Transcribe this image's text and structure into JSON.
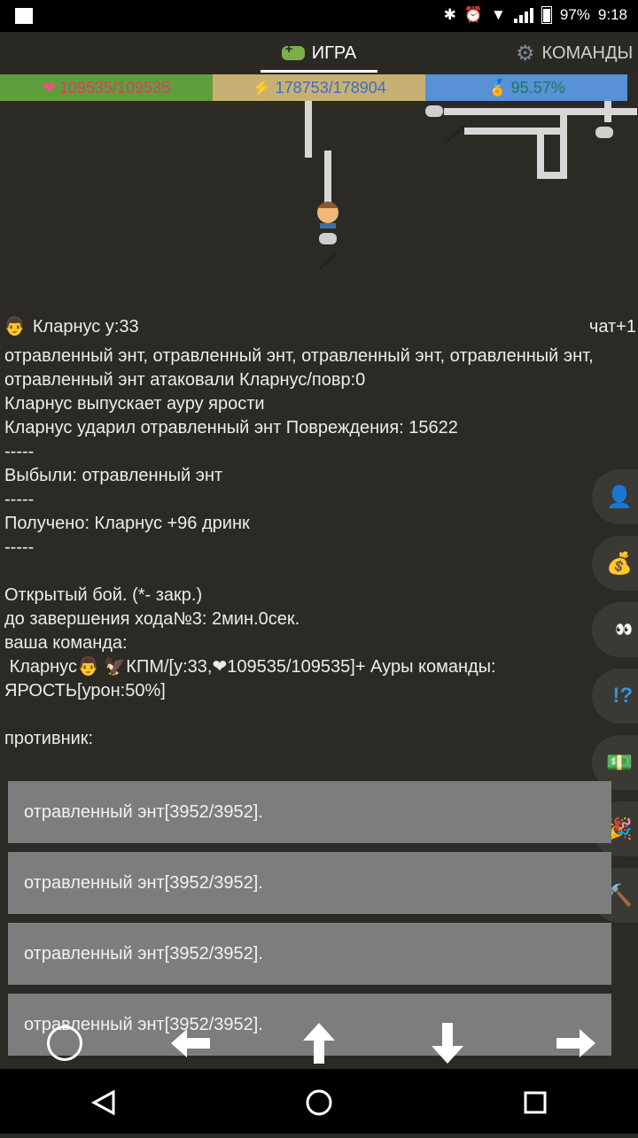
{
  "status_bar": {
    "battery": "97%",
    "time": "9:18",
    "icons": [
      "bluetooth-icon",
      "alarm-icon",
      "wifi-icon",
      "signal-icon",
      "battery-icon"
    ]
  },
  "tabs": [
    {
      "label": "ИГРА",
      "icon": "gamepad-icon",
      "active": true
    },
    {
      "label": "КОМАНДЫ",
      "icon": "gear-icon",
      "active": false
    }
  ],
  "stats": {
    "hp": "109535/109535",
    "energy": "178753/178904",
    "xp": "95.57%"
  },
  "player_header": {
    "name": "Кларнус  у:33",
    "chat": "чат+1"
  },
  "log_text": "отравленный энт, отравленный энт, отравленный энт, отравленный энт, отравленный энт атаковали Кларнус/повр:0\nКларнус выпускает ауру ярости\nКларнус ударил отравленный энт Повреждения: 15622\n-----\nВыбыли: отравленный энт\n-----\nПолучено: Кларнус +96 дринк\n-----\n\nОткрытый бой. (*- закр.)\nдо завершения хода№3: 2мин.0сек.\nваша команда:\n Кларнус👨 🦅КПМ/[у:33,❤109535/109535]+ Ауры команды:\nЯРОСТЬ[урон:50%]\n\nпротивник:",
  "enemies": [
    "отравленный энт[3952/3952].",
    "отравленный энт[3952/3952].",
    "отравленный энт[3952/3952].",
    "отравленный энт[3952/3952]."
  ],
  "side_buttons": [
    "person-icon",
    "money-bag-icon",
    "eyes-icon",
    "question-exclamation-icon",
    "banknote-icon",
    "party-popper-icon",
    "hammer-icon"
  ],
  "dpad": [
    "circle-button",
    "arrow-left",
    "arrow-up",
    "arrow-down",
    "arrow-right"
  ],
  "colors": {
    "background": "#2c2a25",
    "hp_bar": "#5e9e3d",
    "energy_bar": "#c8b074",
    "xp_bar": "#5891d6",
    "enemy_button": "#7d7d7d"
  }
}
